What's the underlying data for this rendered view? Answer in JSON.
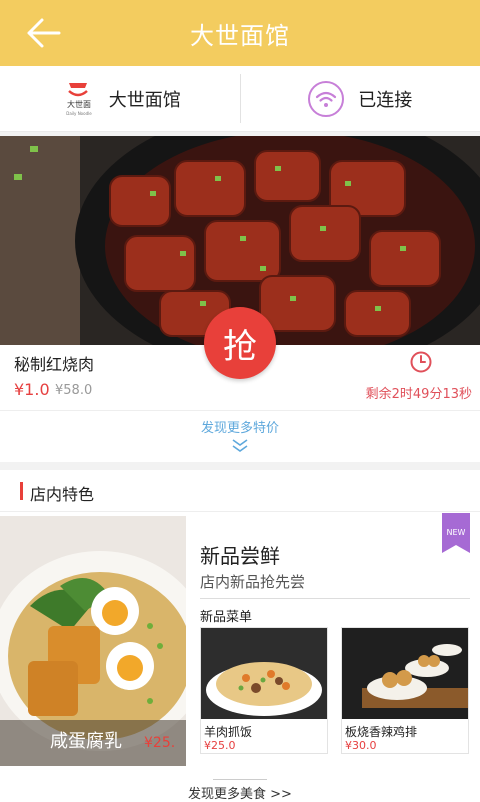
{
  "header": {
    "title": "大世面馆",
    "back_icon": "arrow-left-icon"
  },
  "store_bar": {
    "store_name": "大世面馆",
    "logo_text": "大世面",
    "logo_subtext": "Daily Noodle",
    "wifi_icon": "wifi-icon",
    "wifi_status": "已连接"
  },
  "deal": {
    "name": "秘制红烧肉",
    "price": "¥1.0",
    "original_price": "¥58.0",
    "grab_label": "抢",
    "countdown": "剩余2时49分13秒",
    "more_label": "发现更多特价"
  },
  "specialties": {
    "title": "店内特色",
    "feature": {
      "name": "咸蛋腐乳",
      "price": "¥25."
    },
    "new_badge": "NEW",
    "promo_title": "新品尝鲜",
    "promo_subtitle": "店内新品抢先尝",
    "new_dishes_label": "新品菜单",
    "dishes": [
      {
        "name": "羊肉抓饭",
        "price": "¥25.0"
      },
      {
        "name": "板烧香辣鸡排",
        "price": "¥30.0"
      }
    ],
    "more_label": "发现更多美食 >>"
  },
  "colors": {
    "header": "#f3cc5f",
    "accent_red": "#e8403a",
    "link_blue": "#5ea8dc",
    "badge_purple": "#a66ad4"
  }
}
